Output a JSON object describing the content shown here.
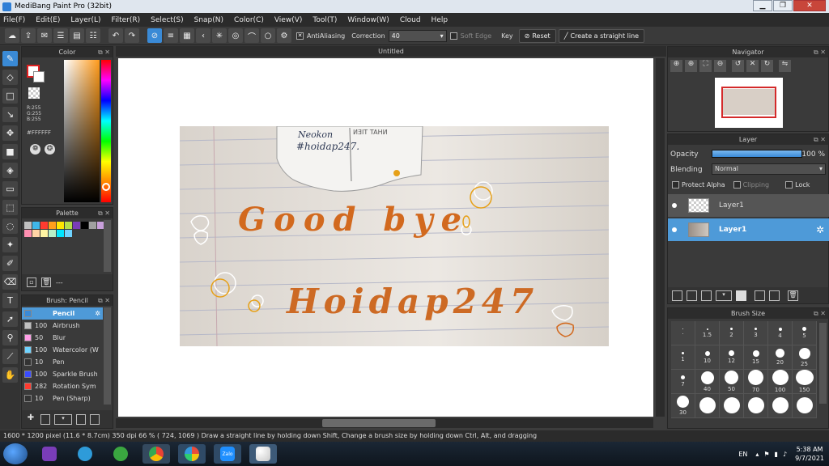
{
  "window": {
    "title": "MediBang Paint Pro (32bit)"
  },
  "menu": [
    "File(F)",
    "Edit(E)",
    "Layer(L)",
    "Filter(R)",
    "Select(S)",
    "Snap(N)",
    "Color(C)",
    "View(V)",
    "Tool(T)",
    "Window(W)",
    "Cloud",
    "Help"
  ],
  "toolbar": {
    "antialiasing_label": "AntiAliasing",
    "correction_label": "Correction",
    "correction_value": "40",
    "soft_edge_label": "Soft Edge",
    "key_label": "Key",
    "reset_label": "Reset",
    "straight_line_label": "Create a straight line"
  },
  "color_panel": {
    "title": "Color",
    "r": "R:255",
    "g": "G:255",
    "b": "B:255",
    "hex": "#FFFFFF"
  },
  "palette_panel": {
    "title": "Palette",
    "swatches": [
      "#c0c0c0",
      "#3fb7e8",
      "#ff3b30",
      "#ff9f1c",
      "#ffe600",
      "#b6e04a",
      "#7a3db8",
      "#000000",
      "#a0a0a0",
      "#c9a0dc",
      "#ff8fb1",
      "#ffd3a5",
      "#fff4a3",
      "#b8f0c8",
      "#00e5ff",
      "#6fd3ff"
    ],
    "footer": "---"
  },
  "brush_panel": {
    "title": "Brush: Pencil",
    "items": [
      {
        "size": "",
        "name": "Pencil",
        "color": "#3a8ad6",
        "active": true
      },
      {
        "size": "100",
        "name": "Airbrush",
        "color": "#c0c0c0",
        "active": false
      },
      {
        "size": "50",
        "name": "Blur",
        "color": "#ff9ee6",
        "active": false
      },
      {
        "size": "100",
        "name": "Watercolor (W",
        "color": "#6fd3ff",
        "active": false
      },
      {
        "size": "10",
        "name": "Pen",
        "color": "#333333",
        "active": false
      },
      {
        "size": "100",
        "name": "Sparkle Brush",
        "color": "#3a4cff",
        "active": false
      },
      {
        "size": "282",
        "name": "Rotation Sym",
        "color": "#ff3b30",
        "active": false
      },
      {
        "size": "10",
        "name": "Pen (Sharp)",
        "color": "#333333",
        "active": false
      }
    ]
  },
  "canvas": {
    "tab_title": "Untitled"
  },
  "photo_text": {
    "note_line1": "Neokon",
    "note_line2": "#hoidap247.",
    "note_flip": "NHAT TIEN",
    "line1": "Good bye",
    "line2": "Hoidap247"
  },
  "navigator": {
    "title": "Navigator"
  },
  "layer_panel": {
    "title": "Layer",
    "opacity_label": "Opacity",
    "opacity_value": "100 %",
    "opacity_fraction": 1.0,
    "blending_label": "Blending",
    "blending_value": "Normal",
    "protect_alpha_label": "Protect Alpha",
    "clipping_label": "Clipping",
    "lock_label": "Lock",
    "layers": [
      {
        "name": "Layer1",
        "selected": false
      },
      {
        "name": "Layer1",
        "selected": true
      }
    ]
  },
  "brush_size_panel": {
    "title": "Brush Size",
    "sizes": [
      "·",
      "1.5",
      "2",
      "3",
      "4",
      "5",
      "1",
      "10",
      "12",
      "15",
      "20",
      "25",
      "7",
      "40",
      "50",
      "70",
      "100",
      "150",
      "30",
      "",
      "",
      "",
      "",
      ""
    ]
  },
  "status_bar": {
    "text": "1600 * 1200 pixel   (11.6 * 8.7cm)   350 dpi   66 %   ( 724, 1069 )   Draw a straight line by holding down Shift, Change a brush size by holding down Ctrl, Alt, and dragging"
  },
  "taskbar": {
    "lang": "EN",
    "time": "5:38 AM",
    "date": "9/7/2021",
    "zalo": "Zalo"
  },
  "colors": {
    "accent": "#3a8ad6",
    "selection": "#4e9ad8",
    "orange_ink": "#d2691e"
  }
}
